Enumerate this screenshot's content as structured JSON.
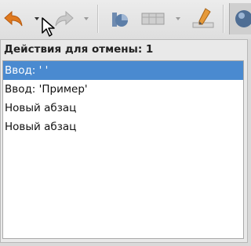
{
  "popup": {
    "title": "Действия для отмены: 1",
    "items": [
      {
        "label": "Ввод: ' '",
        "selected": true
      },
      {
        "label": "Ввод: 'Пример'",
        "selected": false
      },
      {
        "label": "Новый абзац",
        "selected": false
      },
      {
        "label": "Новый абзац",
        "selected": false
      }
    ]
  },
  "colors": {
    "selection": "#4a8ad0",
    "undo_arrow": "#e07a1f"
  },
  "icons": [
    "undo-icon",
    "redo-icon",
    "chart-icon",
    "table-icon",
    "pencil-icon",
    "sphere-icon",
    "mouse-cursor-icon"
  ]
}
